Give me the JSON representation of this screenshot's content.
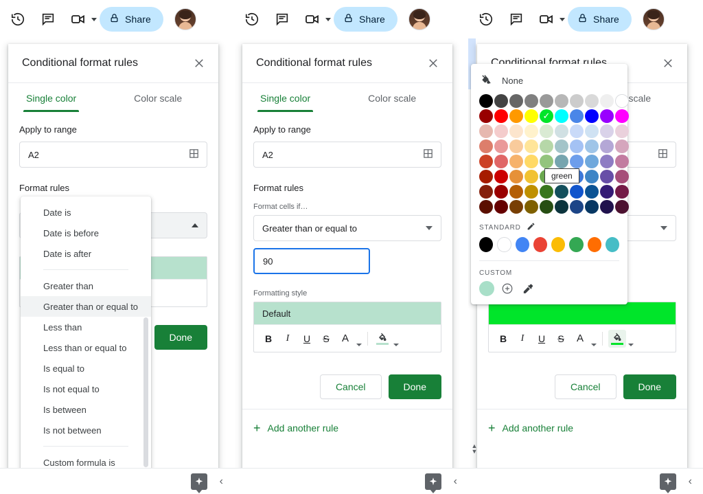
{
  "toolbar": {
    "history_icon": "history-clock-icon",
    "comment_icon": "comment-icon",
    "meet_icon": "video-camera-icon",
    "share_label": "Share",
    "lock_icon": "lock-icon",
    "avatar_icon": "user-avatar"
  },
  "dialog": {
    "title": "Conditional format rules",
    "close_icon": "close-icon",
    "tabs": [
      {
        "label": "Single color",
        "active": true
      },
      {
        "label": "Color scale",
        "active": false
      }
    ],
    "apply_to_range_label": "Apply to range",
    "range_value": "A2",
    "range_picker_icon": "grid-select-icon",
    "format_rules_label": "Format rules",
    "format_cells_if_label": "Format cells if…",
    "operator_value": "Greater than or equal to",
    "operator_caret_icon": "chevron-down-icon",
    "threshold_value": "90",
    "formatting_style_label": "Formatting style",
    "style_sample_text": "Default",
    "style_buttons": [
      {
        "name": "bold-button",
        "label": "B"
      },
      {
        "name": "italic-button",
        "label": "I"
      },
      {
        "name": "underline-button",
        "label": "U"
      },
      {
        "name": "strikethrough-button",
        "label": "S"
      },
      {
        "name": "text-color-button",
        "label": "A"
      },
      {
        "name": "fill-color-button",
        "label": "⬟"
      }
    ],
    "cancel_label": "Cancel",
    "done_label": "Done",
    "add_another_rule_label": "Add another rule",
    "add_icon": "plus-icon"
  },
  "operator_menu": {
    "groups": [
      {
        "items": [
          "Date is",
          "Date is before",
          "Date is after"
        ]
      },
      {
        "items": [
          "Greater than",
          "Greater than or equal to",
          "Less than",
          "Less than or equal to",
          "Is equal to",
          "Is not equal to",
          "Is between",
          "Is not between"
        ]
      },
      {
        "items": [
          "Custom formula is"
        ]
      }
    ],
    "highlighted": "Greater than or equal to",
    "vertical_scrollbar": "menu-vertical-scrollbar",
    "horizontal_scrollbar": "menu-horizontal-scrollbar"
  },
  "color_picker": {
    "none_label": "None",
    "none_icon": "no-color-icon",
    "selected_color": "#00e52a",
    "selected_check_icon": "check-icon",
    "tooltip_text": "green",
    "standard_label": "STANDARD",
    "standard_edit_icon": "pencil-icon",
    "custom_label": "CUSTOM",
    "custom_add_icon": "plus-circle-icon",
    "custom_pick_icon": "eyedropper-icon",
    "custom_swatch": "#a8dfc8",
    "grid": [
      [
        "#000000",
        "#434343",
        "#666666",
        "#808080",
        "#999999",
        "#b7b7b7",
        "#cccccc",
        "#d9d9d9",
        "#efefef",
        "#ffffff"
      ],
      [
        "#980000",
        "#ff0000",
        "#ff9900",
        "#ffff00",
        "#00e52a",
        "#00ffff",
        "#4a86e8",
        "#0000ff",
        "#9900ff",
        "#ff00ff"
      ],
      [
        "#e6b8af",
        "#f4cccc",
        "#fce5cd",
        "#fff2cc",
        "#d9ead3",
        "#d0e0e3",
        "#c9daf8",
        "#cfe2f3",
        "#d9d2e9",
        "#ead1dc"
      ],
      [
        "#dd7e6b",
        "#ea9999",
        "#f9cb9c",
        "#ffe599",
        "#b6d7a8",
        "#a2c4c9",
        "#a4c2f4",
        "#9fc5e8",
        "#b4a7d6",
        "#d5a6bd"
      ],
      [
        "#cc4125",
        "#e06666",
        "#f6b26b",
        "#ffd966",
        "#93c47d",
        "#76a5af",
        "#6d9eeb",
        "#6fa8dc",
        "#8e7cc3",
        "#c27ba0"
      ],
      [
        "#a61c00",
        "#cc0000",
        "#e69138",
        "#f1c232",
        "#6aa84f",
        "#45818e",
        "#3c78d8",
        "#3d85c6",
        "#674ea7",
        "#a64d79"
      ],
      [
        "#85200c",
        "#990000",
        "#b45f06",
        "#bf9000",
        "#38761d",
        "#134f5c",
        "#1155cc",
        "#0b5394",
        "#351c75",
        "#741b47"
      ],
      [
        "#5b0f00",
        "#660000",
        "#783f04",
        "#7f6000",
        "#274e13",
        "#0c343d",
        "#1c4587",
        "#073763",
        "#20124d",
        "#4c1130"
      ]
    ],
    "standard_colors": [
      "#000000",
      "#ffffff",
      "#4285f4",
      "#ea4335",
      "#fbbc04",
      "#34a853",
      "#ff6d01",
      "#46bdc6"
    ]
  },
  "style_preview": {
    "panel1_fill": "#b7e1cd",
    "panel2_fill": "#b7e1cd",
    "panel3_fill": "#00e52a",
    "panel1_text": "",
    "panel2_text": "Default",
    "panel3_text": ""
  },
  "bottom_bar": {
    "explore_icon": "explore-sparkle-icon",
    "collapse_icon": "chevron-left-icon"
  }
}
